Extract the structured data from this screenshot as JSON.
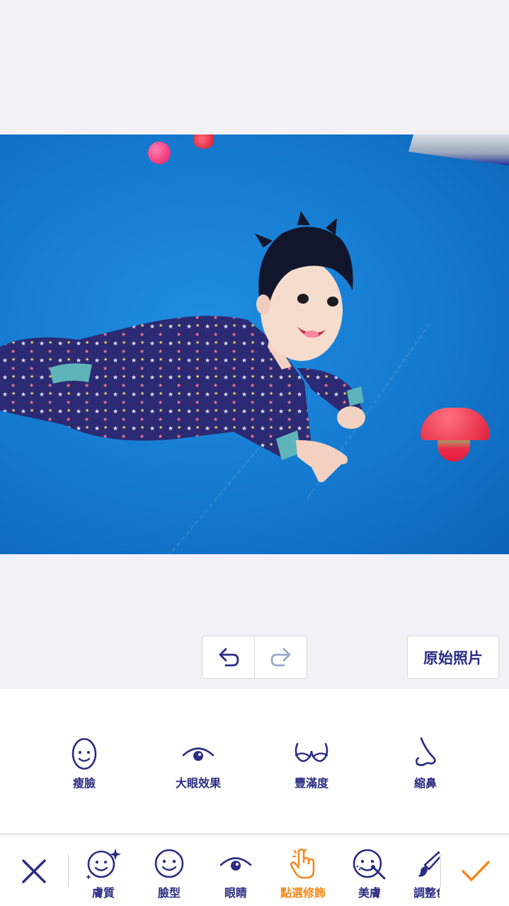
{
  "editor": {
    "original_photo_label": "原始照片"
  },
  "icons": {
    "undo": "undo-arrow-icon",
    "redo": "redo-arrow-icon",
    "cancel": "close-x-icon",
    "confirm": "checkmark-icon"
  },
  "sub_tools": [
    {
      "label": "瘦臉",
      "icon": "slim-face-icon"
    },
    {
      "label": "大眼效果",
      "icon": "eye-icon"
    },
    {
      "label": "豐滿度",
      "icon": "bust-icon"
    },
    {
      "label": "縮鼻",
      "icon": "nose-icon"
    }
  ],
  "tabs": [
    {
      "label": "膚質",
      "icon": "sparkle-face-icon",
      "active": false
    },
    {
      "label": "臉型",
      "icon": "face-icon",
      "active": false
    },
    {
      "label": "眼睛",
      "icon": "eye-icon",
      "active": false
    },
    {
      "label": "點選修飾",
      "icon": "tap-hand-icon",
      "active": true
    },
    {
      "label": "美膚",
      "icon": "face-brush-icon",
      "active": false
    },
    {
      "label": "調整色",
      "icon": "brush-icon",
      "active": false
    }
  ],
  "colors": {
    "primary": "#2b2c83",
    "accent": "#f28a1f",
    "background": "#f2f2f6",
    "disabled": "#9fa6cc"
  }
}
